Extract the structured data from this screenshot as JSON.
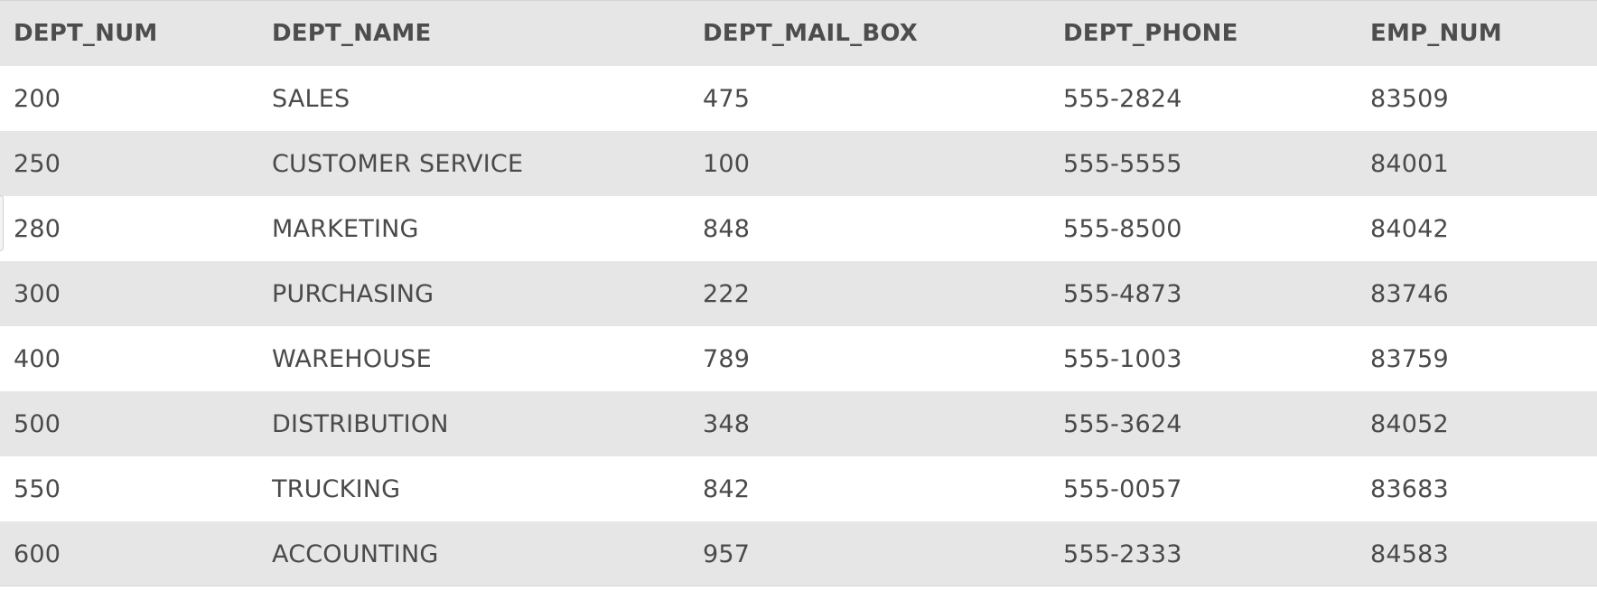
{
  "table": {
    "columns": [
      "DEPT_NUM",
      "DEPT_NAME",
      "DEPT_MAIL_BOX",
      "DEPT_PHONE",
      "EMP_NUM"
    ],
    "rows": [
      [
        "200",
        "SALES",
        "475",
        "555-2824",
        "83509"
      ],
      [
        "250",
        "CUSTOMER SERVICE",
        "100",
        "555-5555",
        "84001"
      ],
      [
        "280",
        "MARKETING",
        "848",
        "555-8500",
        "84042"
      ],
      [
        "300",
        "PURCHASING",
        "222",
        "555-4873",
        "83746"
      ],
      [
        "400",
        "WAREHOUSE",
        "789",
        "555-1003",
        "83759"
      ],
      [
        "500",
        "DISTRIBUTION",
        "348",
        "555-3624",
        "84052"
      ],
      [
        "550",
        "TRUCKING",
        "842",
        "555-0057",
        "83683"
      ],
      [
        "600",
        "ACCOUNTING",
        "957",
        "555-2333",
        "84583"
      ]
    ]
  },
  "colors": {
    "header_background": "#e6e6e6",
    "stripe_background": "#e6e6e6",
    "row_background": "#ffffff",
    "text": "#4a4a4a"
  }
}
